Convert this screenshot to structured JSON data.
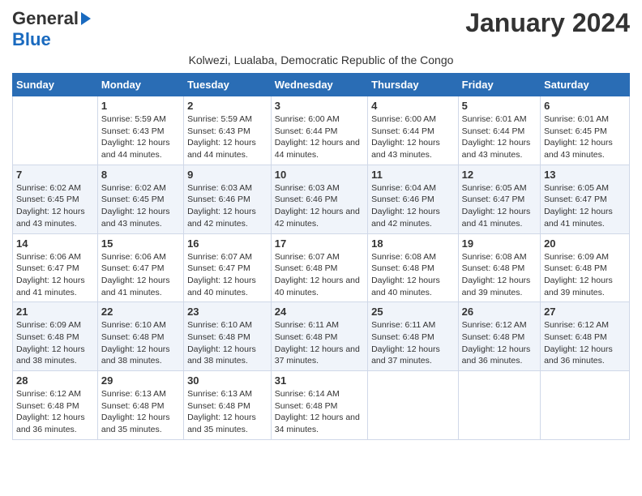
{
  "header": {
    "logo_line1": "General",
    "logo_line2": "Blue",
    "title": "January 2024",
    "subtitle": "Kolwezi, Lualaba, Democratic Republic of the Congo"
  },
  "calendar": {
    "days_of_week": [
      "Sunday",
      "Monday",
      "Tuesday",
      "Wednesday",
      "Thursday",
      "Friday",
      "Saturday"
    ],
    "weeks": [
      [
        {
          "num": "",
          "sunrise": "",
          "sunset": "",
          "daylight": ""
        },
        {
          "num": "1",
          "sunrise": "Sunrise: 5:59 AM",
          "sunset": "Sunset: 6:43 PM",
          "daylight": "Daylight: 12 hours and 44 minutes."
        },
        {
          "num": "2",
          "sunrise": "Sunrise: 5:59 AM",
          "sunset": "Sunset: 6:43 PM",
          "daylight": "Daylight: 12 hours and 44 minutes."
        },
        {
          "num": "3",
          "sunrise": "Sunrise: 6:00 AM",
          "sunset": "Sunset: 6:44 PM",
          "daylight": "Daylight: 12 hours and 44 minutes."
        },
        {
          "num": "4",
          "sunrise": "Sunrise: 6:00 AM",
          "sunset": "Sunset: 6:44 PM",
          "daylight": "Daylight: 12 hours and 43 minutes."
        },
        {
          "num": "5",
          "sunrise": "Sunrise: 6:01 AM",
          "sunset": "Sunset: 6:44 PM",
          "daylight": "Daylight: 12 hours and 43 minutes."
        },
        {
          "num": "6",
          "sunrise": "Sunrise: 6:01 AM",
          "sunset": "Sunset: 6:45 PM",
          "daylight": "Daylight: 12 hours and 43 minutes."
        }
      ],
      [
        {
          "num": "7",
          "sunrise": "Sunrise: 6:02 AM",
          "sunset": "Sunset: 6:45 PM",
          "daylight": "Daylight: 12 hours and 43 minutes."
        },
        {
          "num": "8",
          "sunrise": "Sunrise: 6:02 AM",
          "sunset": "Sunset: 6:45 PM",
          "daylight": "Daylight: 12 hours and 43 minutes."
        },
        {
          "num": "9",
          "sunrise": "Sunrise: 6:03 AM",
          "sunset": "Sunset: 6:46 PM",
          "daylight": "Daylight: 12 hours and 42 minutes."
        },
        {
          "num": "10",
          "sunrise": "Sunrise: 6:03 AM",
          "sunset": "Sunset: 6:46 PM",
          "daylight": "Daylight: 12 hours and 42 minutes."
        },
        {
          "num": "11",
          "sunrise": "Sunrise: 6:04 AM",
          "sunset": "Sunset: 6:46 PM",
          "daylight": "Daylight: 12 hours and 42 minutes."
        },
        {
          "num": "12",
          "sunrise": "Sunrise: 6:05 AM",
          "sunset": "Sunset: 6:47 PM",
          "daylight": "Daylight: 12 hours and 41 minutes."
        },
        {
          "num": "13",
          "sunrise": "Sunrise: 6:05 AM",
          "sunset": "Sunset: 6:47 PM",
          "daylight": "Daylight: 12 hours and 41 minutes."
        }
      ],
      [
        {
          "num": "14",
          "sunrise": "Sunrise: 6:06 AM",
          "sunset": "Sunset: 6:47 PM",
          "daylight": "Daylight: 12 hours and 41 minutes."
        },
        {
          "num": "15",
          "sunrise": "Sunrise: 6:06 AM",
          "sunset": "Sunset: 6:47 PM",
          "daylight": "Daylight: 12 hours and 41 minutes."
        },
        {
          "num": "16",
          "sunrise": "Sunrise: 6:07 AM",
          "sunset": "Sunset: 6:47 PM",
          "daylight": "Daylight: 12 hours and 40 minutes."
        },
        {
          "num": "17",
          "sunrise": "Sunrise: 6:07 AM",
          "sunset": "Sunset: 6:48 PM",
          "daylight": "Daylight: 12 hours and 40 minutes."
        },
        {
          "num": "18",
          "sunrise": "Sunrise: 6:08 AM",
          "sunset": "Sunset: 6:48 PM",
          "daylight": "Daylight: 12 hours and 40 minutes."
        },
        {
          "num": "19",
          "sunrise": "Sunrise: 6:08 AM",
          "sunset": "Sunset: 6:48 PM",
          "daylight": "Daylight: 12 hours and 39 minutes."
        },
        {
          "num": "20",
          "sunrise": "Sunrise: 6:09 AM",
          "sunset": "Sunset: 6:48 PM",
          "daylight": "Daylight: 12 hours and 39 minutes."
        }
      ],
      [
        {
          "num": "21",
          "sunrise": "Sunrise: 6:09 AM",
          "sunset": "Sunset: 6:48 PM",
          "daylight": "Daylight: 12 hours and 38 minutes."
        },
        {
          "num": "22",
          "sunrise": "Sunrise: 6:10 AM",
          "sunset": "Sunset: 6:48 PM",
          "daylight": "Daylight: 12 hours and 38 minutes."
        },
        {
          "num": "23",
          "sunrise": "Sunrise: 6:10 AM",
          "sunset": "Sunset: 6:48 PM",
          "daylight": "Daylight: 12 hours and 38 minutes."
        },
        {
          "num": "24",
          "sunrise": "Sunrise: 6:11 AM",
          "sunset": "Sunset: 6:48 PM",
          "daylight": "Daylight: 12 hours and 37 minutes."
        },
        {
          "num": "25",
          "sunrise": "Sunrise: 6:11 AM",
          "sunset": "Sunset: 6:48 PM",
          "daylight": "Daylight: 12 hours and 37 minutes."
        },
        {
          "num": "26",
          "sunrise": "Sunrise: 6:12 AM",
          "sunset": "Sunset: 6:48 PM",
          "daylight": "Daylight: 12 hours and 36 minutes."
        },
        {
          "num": "27",
          "sunrise": "Sunrise: 6:12 AM",
          "sunset": "Sunset: 6:48 PM",
          "daylight": "Daylight: 12 hours and 36 minutes."
        }
      ],
      [
        {
          "num": "28",
          "sunrise": "Sunrise: 6:12 AM",
          "sunset": "Sunset: 6:48 PM",
          "daylight": "Daylight: 12 hours and 36 minutes."
        },
        {
          "num": "29",
          "sunrise": "Sunrise: 6:13 AM",
          "sunset": "Sunset: 6:48 PM",
          "daylight": "Daylight: 12 hours and 35 minutes."
        },
        {
          "num": "30",
          "sunrise": "Sunrise: 6:13 AM",
          "sunset": "Sunset: 6:48 PM",
          "daylight": "Daylight: 12 hours and 35 minutes."
        },
        {
          "num": "31",
          "sunrise": "Sunrise: 6:14 AM",
          "sunset": "Sunset: 6:48 PM",
          "daylight": "Daylight: 12 hours and 34 minutes."
        },
        {
          "num": "",
          "sunrise": "",
          "sunset": "",
          "daylight": ""
        },
        {
          "num": "",
          "sunrise": "",
          "sunset": "",
          "daylight": ""
        },
        {
          "num": "",
          "sunrise": "",
          "sunset": "",
          "daylight": ""
        }
      ]
    ]
  }
}
